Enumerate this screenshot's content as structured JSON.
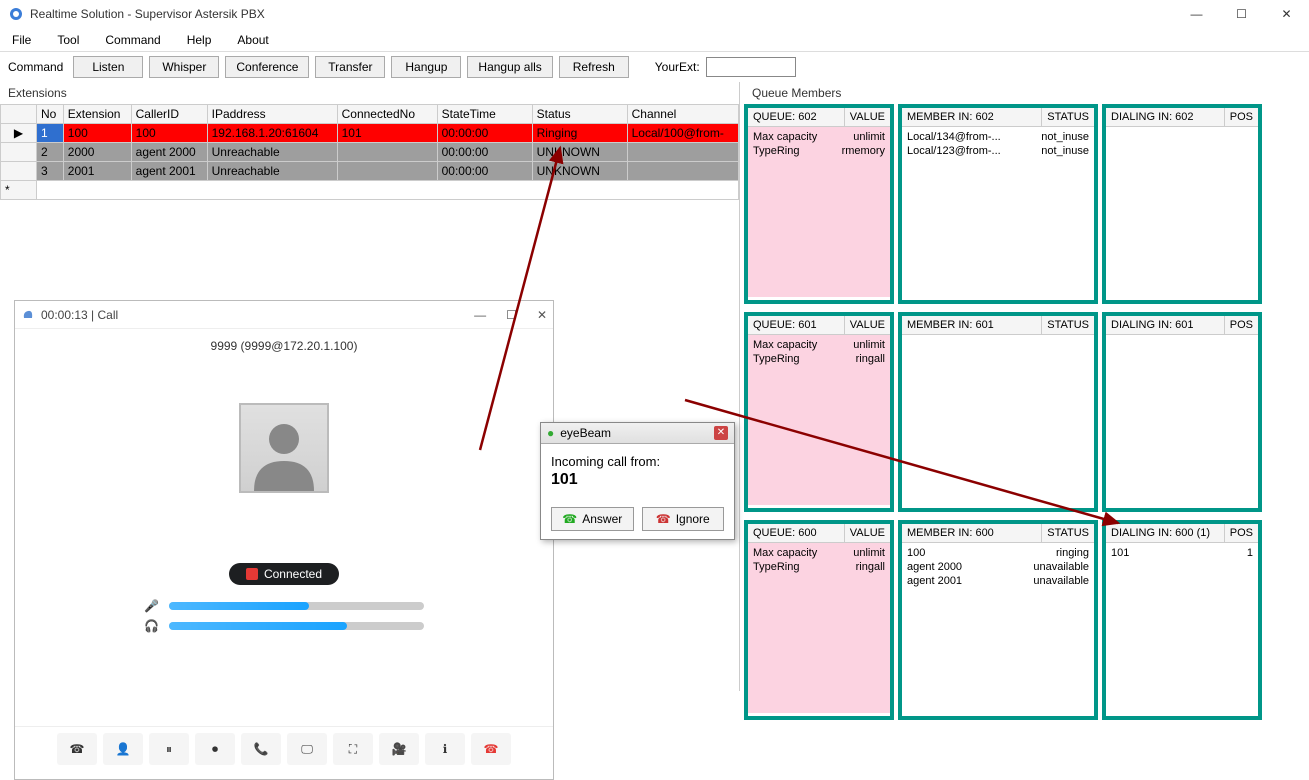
{
  "window": {
    "title": "Realtime Solution - Supervisor Astersik PBX"
  },
  "menu": {
    "file": "File",
    "tool": "Tool",
    "command": "Command",
    "help": "Help",
    "about": "About"
  },
  "command": {
    "label": "Command",
    "listen": "Listen",
    "whisper": "Whisper",
    "conference": "Conference",
    "transfer": "Transfer",
    "hangup": "Hangup",
    "hangup_alls": "Hangup alls",
    "refresh": "Refresh",
    "yourext_label": "YourExt:",
    "yourext_value": ""
  },
  "extensions": {
    "label": "Extensions",
    "headers": {
      "no": "No",
      "extension": "Extension",
      "callerid": "CallerID",
      "ip": "IPaddress",
      "connected": "ConnectedNo",
      "statetime": "StateTime",
      "status": "Status",
      "channel": "Channel"
    },
    "rows": [
      {
        "no": "1",
        "extension": "100",
        "callerid": "100",
        "ip": "192.168.1.20:61604",
        "connected": "101",
        "statetime": "00:00:00",
        "status": "Ringing",
        "channel": "Local/100@from-",
        "type": "ring",
        "selected": true
      },
      {
        "no": "2",
        "extension": "2000",
        "callerid": "agent 2000",
        "ip": "Unreachable",
        "connected": "",
        "statetime": "00:00:00",
        "status": "UNKNOWN",
        "channel": "",
        "type": "unk"
      },
      {
        "no": "3",
        "extension": "2001",
        "callerid": "agent 2001",
        "ip": "Unreachable",
        "connected": "",
        "statetime": "00:00:00",
        "status": "UNKNOWN",
        "channel": "",
        "type": "unk"
      }
    ]
  },
  "softphone": {
    "title": "00:00:13 | Call",
    "caller": "9999 (9999@172.20.1.100)",
    "connected": "Connected",
    "mic_level": 55,
    "spk_level": 70
  },
  "eyebeam": {
    "title": "eyeBeam",
    "label": "Incoming call from:",
    "number": "101",
    "answer": "Answer",
    "ignore": "Ignore"
  },
  "queue_label": "Queue Members",
  "queues": [
    {
      "queue_hdr": "QUEUE: 602",
      "value_hdr": "VALUE",
      "props": [
        [
          "Max capacity",
          "unlimit"
        ],
        [
          "TypeRing",
          "rmemory"
        ]
      ],
      "member_hdr": "MEMBER IN: 602",
      "status_hdr": "STATUS",
      "members": [
        [
          "Local/134@from-...",
          "not_inuse"
        ],
        [
          "Local/123@from-...",
          "not_inuse"
        ]
      ],
      "dialing_hdr": "DIALING IN: 602",
      "pos_hdr": "POS",
      "dialing": []
    },
    {
      "queue_hdr": "QUEUE: 601",
      "value_hdr": "VALUE",
      "props": [
        [
          "Max capacity",
          "unlimit"
        ],
        [
          "TypeRing",
          "ringall"
        ]
      ],
      "member_hdr": "MEMBER IN: 601",
      "status_hdr": "STATUS",
      "members": [],
      "dialing_hdr": "DIALING IN: 601",
      "pos_hdr": "POS",
      "dialing": []
    },
    {
      "queue_hdr": "QUEUE: 600",
      "value_hdr": "VALUE",
      "props": [
        [
          "Max capacity",
          "unlimit"
        ],
        [
          "TypeRing",
          "ringall"
        ]
      ],
      "member_hdr": "MEMBER IN: 600",
      "status_hdr": "STATUS",
      "members": [
        [
          "100",
          "ringing"
        ],
        [
          "agent 2000",
          "unavailable"
        ],
        [
          "agent 2001",
          "unavailable"
        ]
      ],
      "dialing_hdr": "DIALING IN: 600 (1)",
      "pos_hdr": "POS",
      "dialing": [
        [
          "101",
          "1"
        ]
      ]
    }
  ]
}
